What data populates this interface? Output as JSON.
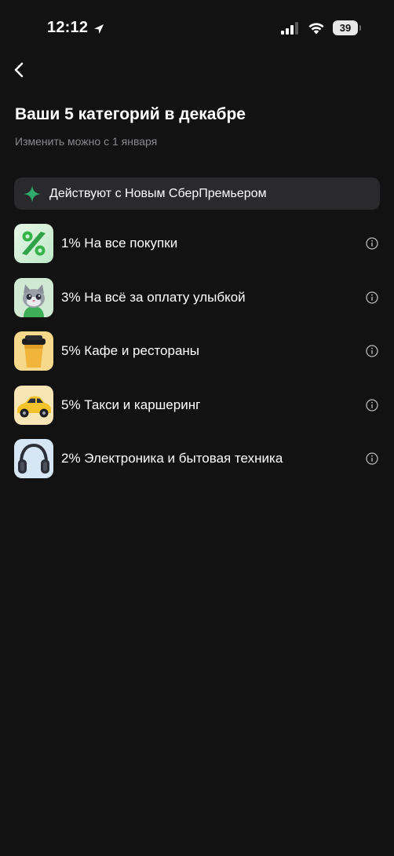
{
  "status_bar": {
    "time": "12:12",
    "battery_level": "39"
  },
  "header": {
    "title": "Ваши 5 категорий в декабре",
    "subtitle": "Изменить можно с 1 января"
  },
  "banner": {
    "text": "Действуют с Новым СберПремьером"
  },
  "categories": [
    {
      "label": "1% На все покупки",
      "icon": "percent-icon"
    },
    {
      "label": "3% На всё за оплату улыбкой",
      "icon": "cat-character-icon"
    },
    {
      "label": "5% Кафе и рестораны",
      "icon": "coffee-cup-icon"
    },
    {
      "label": "5% Такси и каршеринг",
      "icon": "taxi-car-icon"
    },
    {
      "label": "2% Электроника и бытовая техника",
      "icon": "headphones-icon"
    }
  ],
  "colors": {
    "background": "#121212",
    "banner_background": "#2a2a2c",
    "subtitle_text": "#8a8a8e",
    "accent_green": "#2fa86b"
  }
}
